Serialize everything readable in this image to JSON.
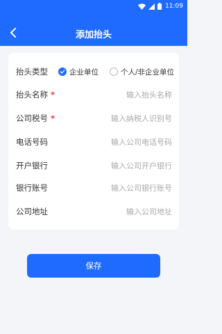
{
  "status_bar": {
    "time": "11:09",
    "icons": [
      "wifi-icon",
      "signal-icon",
      "battery-icon"
    ]
  },
  "nav": {
    "title": "添加抬头",
    "back_icon": "chevron-left-icon"
  },
  "form": {
    "invoice_type": {
      "label": "抬头类型",
      "options": [
        {
          "label": "企业单位",
          "checked": true
        },
        {
          "label": "个人/非企业单位",
          "checked": false
        }
      ]
    },
    "title_name": {
      "label": "抬头名称",
      "required_mark": "*",
      "placeholder": "输入抬头名称",
      "value": ""
    },
    "tax_number": {
      "label": "公司税号",
      "required_mark": "*",
      "placeholder": "输入纳税人识别号",
      "value": ""
    },
    "phone": {
      "label": "电话号码",
      "placeholder": "输入公司电话号码",
      "value": ""
    },
    "bank": {
      "label": "开户银行",
      "placeholder": "输入公司开户银行",
      "value": ""
    },
    "bank_account": {
      "label": "银行账号",
      "placeholder": "输入公司银行账号",
      "value": ""
    },
    "address": {
      "label": "公司地址",
      "placeholder": "输入公司地址",
      "value": ""
    }
  },
  "save_button": {
    "label": "保存"
  },
  "colors": {
    "primary": "#1f6bff",
    "background": "#f3f5f8",
    "required": "#e23a3a",
    "placeholder": "#a9a9a9"
  }
}
